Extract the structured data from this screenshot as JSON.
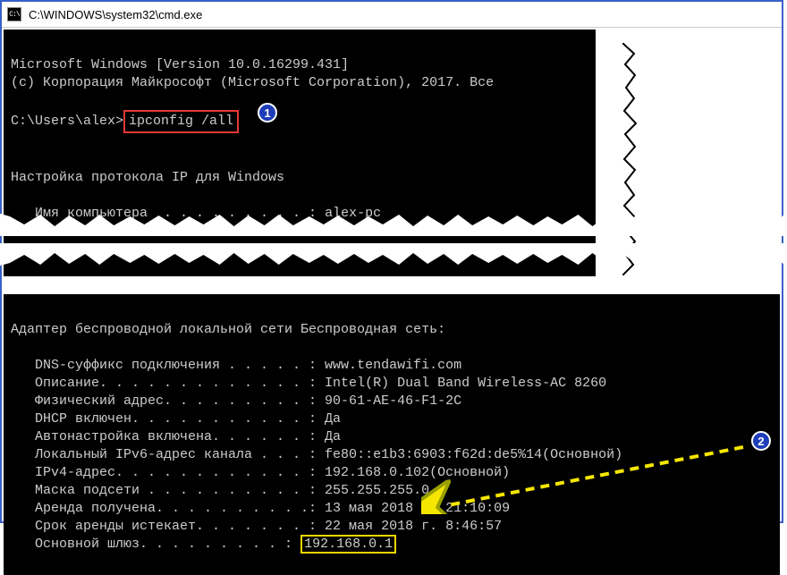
{
  "title_bar": {
    "icon_text": "C:\\",
    "title": "C:\\WINDOWS\\system32\\cmd.exe"
  },
  "badges": {
    "one": "1",
    "two": "2"
  },
  "top": {
    "banner1": "Microsoft Windows [Version 10.0.16299.431]",
    "banner2": "(c) Корпорация Майкрософт (Microsoft Corporation), 2017. Все",
    "prompt": "C:\\Users\\alex>",
    "command": "ipconfig /all",
    "section": "Настройка протокола IP для Windows",
    "hostname_label": "   Имя компьютера  . . . . . . . . . : ",
    "hostname_value": "alex-pc"
  },
  "bottom": {
    "adapter": "Адаптер беспроводной локальной сети Беспроводная сеть:",
    "rows": [
      {
        "label": "DNS-суффикс подключения . . . . . : ",
        "value": "www.tendawifi.com"
      },
      {
        "label": "Описание. . . . . . . . . . . . . : ",
        "value": "Intel(R) Dual Band Wireless-AC 8260"
      },
      {
        "label": "Физический адрес. . . . . . . . . : ",
        "value": "90-61-AE-46-F1-2C"
      },
      {
        "label": "DHCP включен. . . . . . . . . . . : ",
        "value": "Да"
      },
      {
        "label": "Автонастройка включена. . . . . . : ",
        "value": "Да"
      },
      {
        "label": "Локальный IPv6-адрес канала . . . : ",
        "value": "fe80::e1b3:6903:f62d:de5%14(Основной)"
      },
      {
        "label": "IPv4-адрес. . . . . . . . . . . . : ",
        "value": "192.168.0.102(Основной)"
      },
      {
        "label": "Маска подсети . . . . . . . . . . : ",
        "value": "255.255.255.0"
      },
      {
        "label": "Аренда получена. . . . . . . . . .: ",
        "value": "13 мая 2018 г. 21:10:09"
      },
      {
        "label": "Срок аренды истекает. . . . . . . : ",
        "value": "22 мая 2018 г. 8:46:57"
      }
    ],
    "gateway_label": "   Основной шлюз. . . . . . . . . : ",
    "gateway_value": "192.168.0.1"
  }
}
